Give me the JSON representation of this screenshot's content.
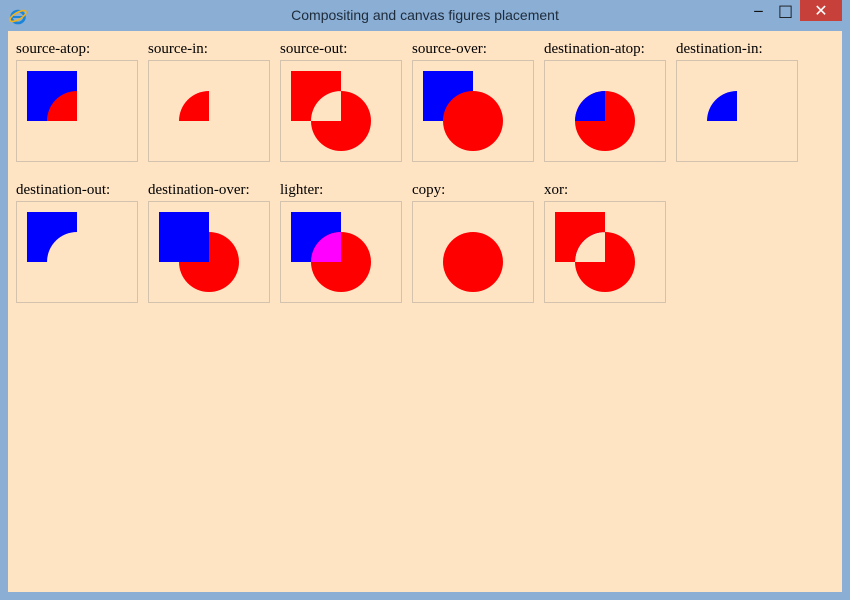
{
  "window": {
    "title": "Compositing and canvas figures placement",
    "controls": {
      "minimize": "‒",
      "maximize": "□",
      "close": "✕"
    },
    "app_icon": "ie-icon"
  },
  "colors": {
    "destination": "#0000ff",
    "source": "#ff0000",
    "lighter_overlap": "#ff00ff",
    "background": "#ffe4c4"
  },
  "demos": [
    {
      "label": "source-atop:",
      "mode": "source-atop"
    },
    {
      "label": "source-in:",
      "mode": "source-in"
    },
    {
      "label": "source-out:",
      "mode": "source-out"
    },
    {
      "label": "source-over:",
      "mode": "source-over"
    },
    {
      "label": "destination-atop:",
      "mode": "destination-atop"
    },
    {
      "label": "destination-in:",
      "mode": "destination-in"
    },
    {
      "label": "destination-out:",
      "mode": "destination-out"
    },
    {
      "label": "destination-over:",
      "mode": "destination-over"
    },
    {
      "label": "lighter:",
      "mode": "lighter"
    },
    {
      "label": "copy:",
      "mode": "copy"
    },
    {
      "label": "xor:",
      "mode": "xor"
    }
  ]
}
